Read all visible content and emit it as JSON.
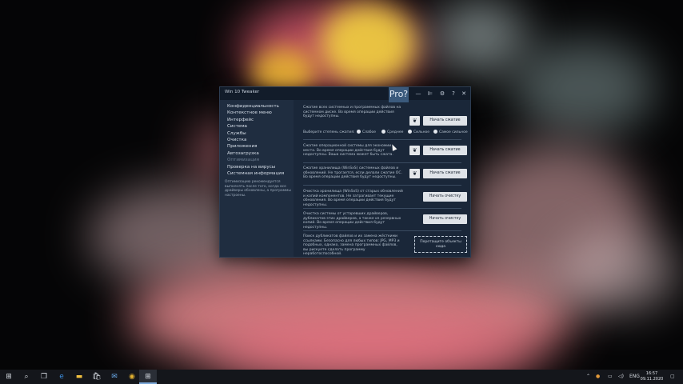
{
  "window": {
    "title": "Win 10 Tweaker",
    "pro_badge": "Pro?",
    "controls": {
      "minimize": "—",
      "pin": "⊫",
      "settings": "⚙",
      "help": "?",
      "close": "✕"
    }
  },
  "sidebar": {
    "items": [
      {
        "label": "Конфиденциальность",
        "enabled": true
      },
      {
        "label": "Контекстное меню",
        "enabled": true
      },
      {
        "label": "Интерфейс",
        "enabled": true
      },
      {
        "label": "Система",
        "enabled": true
      },
      {
        "label": "Службы",
        "enabled": true
      },
      {
        "label": "Очистка",
        "enabled": true
      },
      {
        "label": "Приложения",
        "enabled": true
      },
      {
        "label": "Автозагрузка",
        "enabled": true
      },
      {
        "label": "Оптимизация",
        "enabled": false
      },
      {
        "label": "Проверка на вирусы",
        "enabled": true
      },
      {
        "label": "Системная информация",
        "enabled": true
      }
    ],
    "note": "Оптимизацию рекомендуется выполнять после того, когда все драйверы обновлены, а программы настроены."
  },
  "sections": [
    {
      "desc": "Сжатие всех системных и программных файлов на системном диске. Во время операции действия будут недоступны.",
      "leaf_icon": "leaf-icon",
      "button": "Начать сжатие"
    },
    {
      "desc": "Сжатие операционной системы для экономии места. Во время операции действия будут недоступны. Ваша система может быть сжата.",
      "leaf_icon": "leaf-icon",
      "button": "Начать сжатие"
    },
    {
      "desc": "Сжатие хранилища (WinSxS) системных файлов и обновлений. Не трогается, если делали сжатие ОС. Во время операции действия будут недоступны.",
      "leaf_icon": "leaf-icon",
      "button": "Начать сжатие"
    },
    {
      "desc": "Очистка хранилища (WinSxS) от старых обновлений и копий компонентов. Не затрагивает текущие обновления. Во время операции действия будут недоступны.",
      "button": "Начать очистку"
    },
    {
      "desc": "Очистка системы от устаревших драйверов, дубликатов этих драйверов, а также из резервных копий. Во время операции действия будут недоступны.",
      "button": "Начать очистку"
    },
    {
      "desc": "Поиск дубликатов файлов и их замена жёсткими ссылками. Безопасно для любых типов: JPG, MP3 и подобных, однако, замена программных файлов, вы рискуете сделать программу неработоспособной.",
      "drop_zone": "Перетащите объекты сюда"
    }
  ],
  "compression_level": {
    "label": "Выберите степень сжатия:",
    "options": [
      "Слабое",
      "Среднее",
      "Сильное",
      "Самое сильное"
    ]
  },
  "taskbar": {
    "icons": [
      "windows-start-icon",
      "search-icon",
      "task-view-icon",
      "edge-icon",
      "file-explorer-icon",
      "store-icon",
      "mail-icon",
      "chrome-icon",
      "win10-tweaker-icon"
    ],
    "tray": {
      "language": "ENG",
      "time": "16:57",
      "date": "09.11.2020"
    }
  }
}
